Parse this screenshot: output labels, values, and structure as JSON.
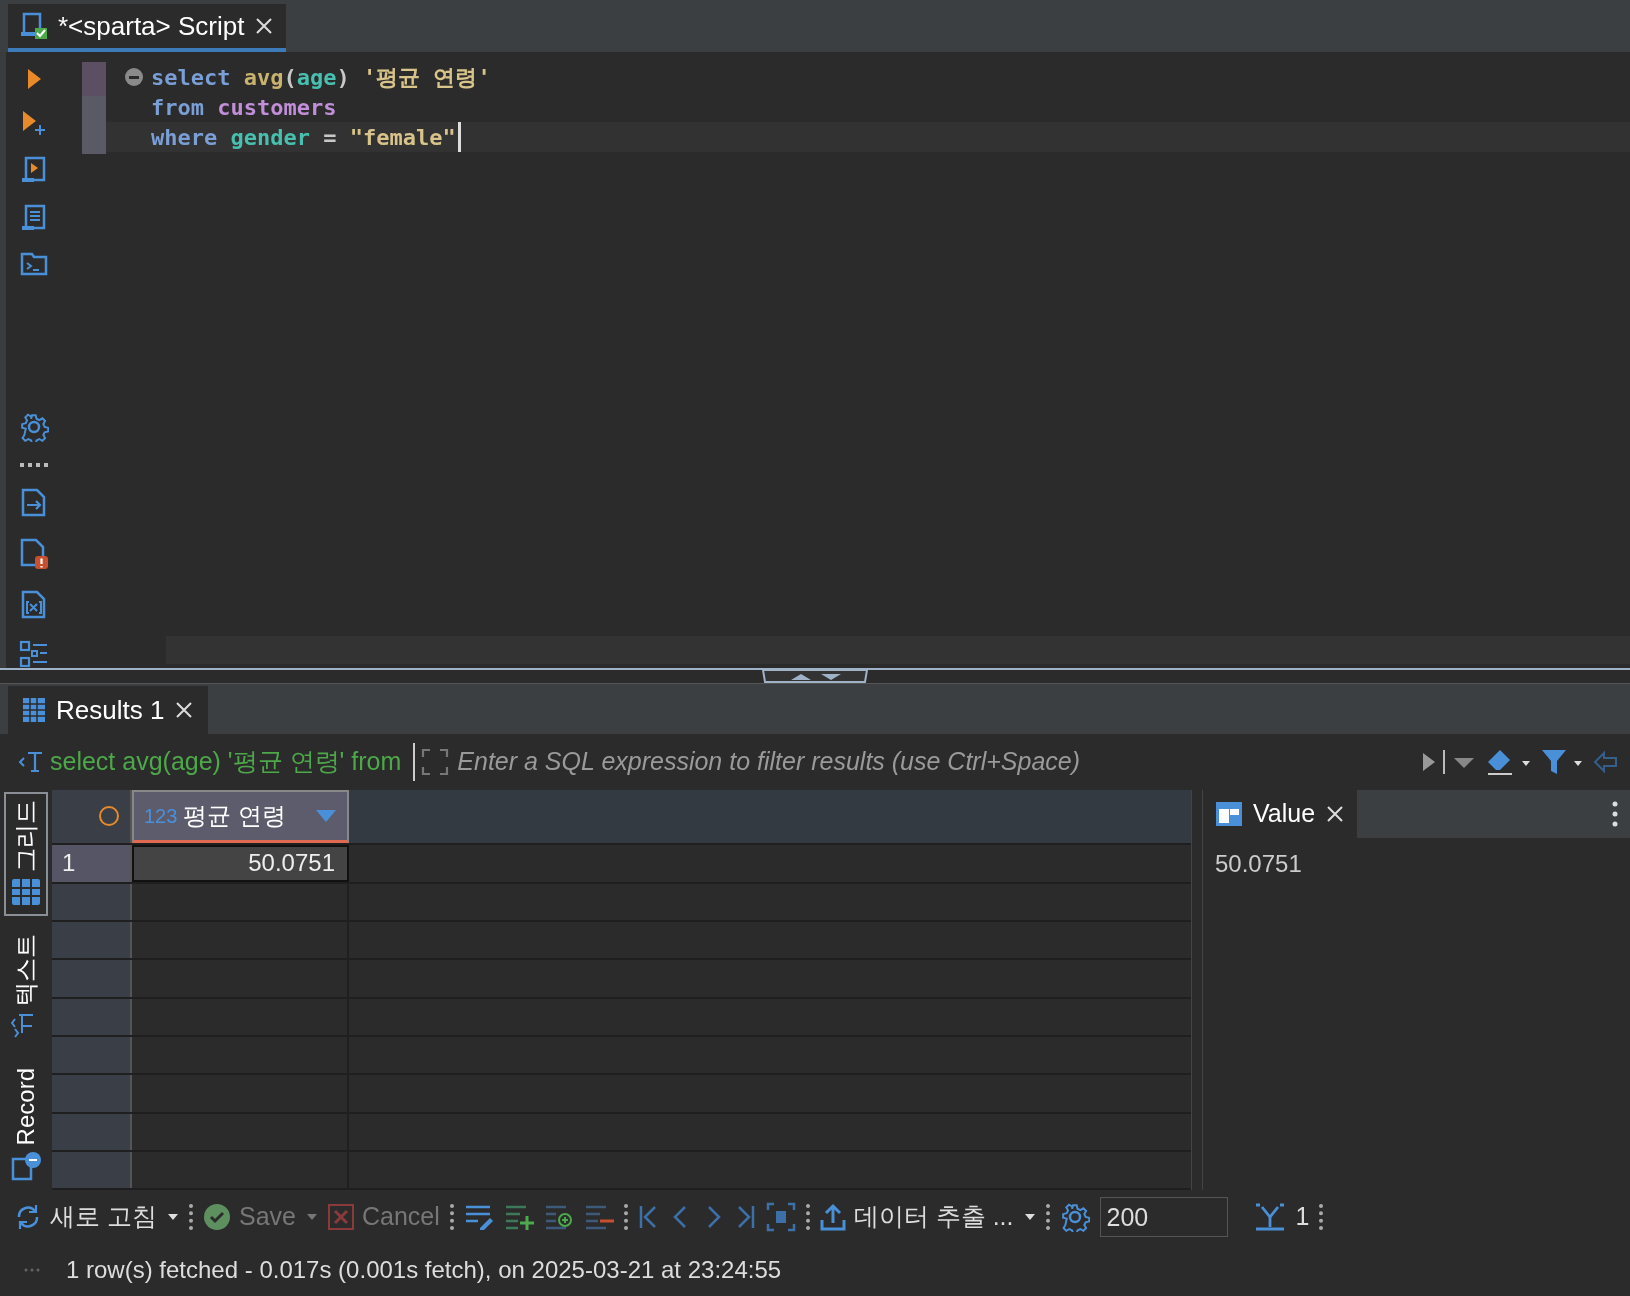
{
  "editor_tab": {
    "title": "*<sparta> Script",
    "selected": true
  },
  "sql_lines": [
    {
      "current": false,
      "foldable": true,
      "tokens": [
        {
          "kind": "keyword",
          "text": "select "
        },
        {
          "kind": "function",
          "text": "avg"
        },
        {
          "kind": "plain",
          "text": "("
        },
        {
          "kind": "column",
          "text": "age"
        },
        {
          "kind": "plain",
          "text": ") "
        },
        {
          "kind": "string",
          "text": "'평균 연령'"
        }
      ]
    },
    {
      "current": false,
      "foldable": false,
      "tokens": [
        {
          "kind": "keyword",
          "text": "from "
        },
        {
          "kind": "table",
          "text": "customers"
        }
      ]
    },
    {
      "current": true,
      "foldable": false,
      "tokens": [
        {
          "kind": "keyword",
          "text": "where "
        },
        {
          "kind": "column",
          "text": "gender"
        },
        {
          "kind": "plain",
          "text": " = "
        },
        {
          "kind": "string",
          "text": "\"female\""
        }
      ]
    }
  ],
  "results_tab": {
    "title": "Results 1"
  },
  "filter": {
    "query": "select avg(age) '평균 연령' from",
    "placeholder": "Enter a SQL expression to filter results (use Ctrl+Space)"
  },
  "view_tabs": [
    {
      "kind": "grid",
      "label": "그리드",
      "selected": true
    },
    {
      "kind": "text",
      "label": "텍스트",
      "selected": false
    },
    {
      "kind": "record",
      "label": "Record",
      "selected": false
    }
  ],
  "grid": {
    "columns": [
      {
        "type_label": "123",
        "name": "평균 연령"
      }
    ],
    "rows": [
      {
        "number": "1",
        "cells": [
          "50.0751"
        ]
      }
    ]
  },
  "value_panel": {
    "title": "Value",
    "value": "50.0751"
  },
  "toolbar": {
    "refresh": "새로 고침",
    "save": {
      "label": "Save",
      "disabled": true
    },
    "cancel": {
      "label": "Cancel",
      "disabled": true
    },
    "export": "데이터 추출 ...",
    "fetch_size": "200",
    "row_count": "1"
  },
  "status": "1 row(s) fetched - 0.017s (0.001s fetch), on 2025-03-21 at 23:24:55"
}
